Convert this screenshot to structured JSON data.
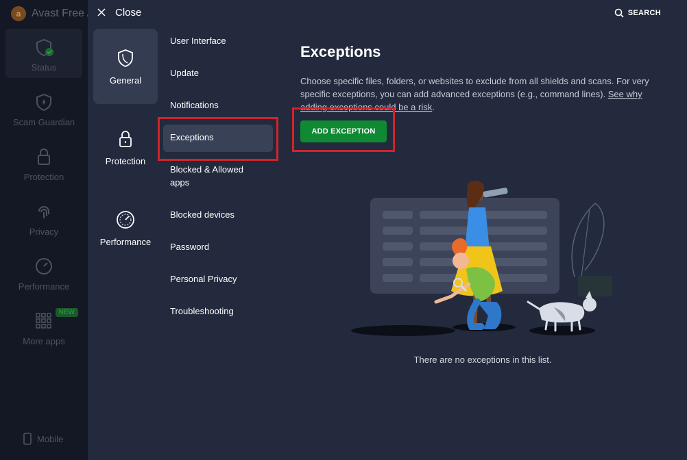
{
  "background_app": {
    "title": "Avast Free A",
    "nav": [
      {
        "label": "Status",
        "icon": "shield-check-icon"
      },
      {
        "label": "Scam Guardian",
        "icon": "scam-shield-icon"
      },
      {
        "label": "Protection",
        "icon": "lock-icon"
      },
      {
        "label": "Privacy",
        "icon": "fingerprint-icon"
      },
      {
        "label": "Performance",
        "icon": "gauge-icon"
      },
      {
        "label": "More apps",
        "icon": "grid-icon",
        "badge": "NEW"
      }
    ],
    "mobile_label": "Mobile"
  },
  "settings": {
    "close_label": "Close",
    "search_label": "SEARCH",
    "categories": [
      {
        "label": "General",
        "icon": "shield-icon",
        "active": true
      },
      {
        "label": "Protection",
        "icon": "lock-icon",
        "active": false
      },
      {
        "label": "Performance",
        "icon": "gauge-icon",
        "active": false
      }
    ],
    "submenu": [
      {
        "label": "User Interface"
      },
      {
        "label": "Update"
      },
      {
        "label": "Notifications"
      },
      {
        "label": "Exceptions",
        "active": true
      },
      {
        "label": "Blocked & Allowed apps"
      },
      {
        "label": "Blocked devices"
      },
      {
        "label": "Password"
      },
      {
        "label": "Personal Privacy"
      },
      {
        "label": "Troubleshooting"
      }
    ]
  },
  "content": {
    "title": "Exceptions",
    "description": "Choose specific files, folders, or websites to exclude from all shields and scans. For very specific exceptions, you can add advanced exceptions (e.g., command lines).",
    "link_text": "See why adding exceptions could be a risk",
    "link_suffix": ".",
    "add_button": "ADD EXCEPTION",
    "empty_text": "There are no exceptions in this list."
  },
  "colors": {
    "accent_green": "#0f8a33",
    "highlight_red": "#d2232a",
    "panel_bg": "#232a3d"
  }
}
